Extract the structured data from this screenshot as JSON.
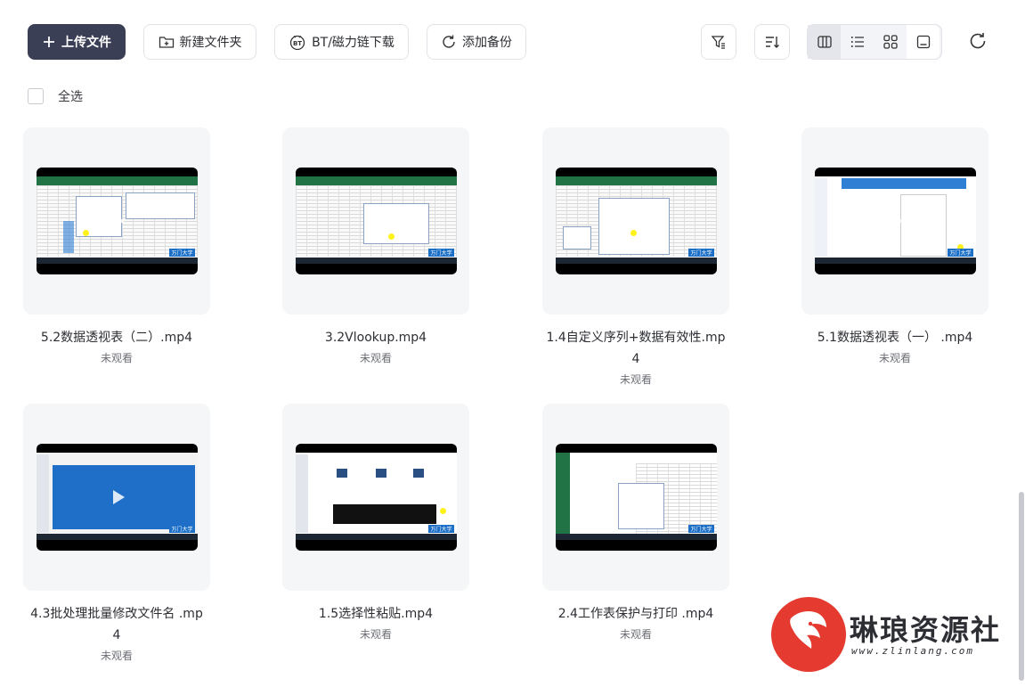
{
  "toolbar": {
    "upload_label": "上传文件",
    "new_folder_label": "新建文件夹",
    "bt_label": "BT/磁力链下载",
    "backup_label": "添加备份",
    "icons": {
      "upload": "plus-icon",
      "new_folder": "folder-plus-icon",
      "bt": "bt-icon",
      "backup": "sync-icon",
      "filter": "filter-icon",
      "sort": "sort-icon",
      "view_columns": "columns-icon",
      "view_list": "list-icon",
      "view_grid": "grid-icon",
      "view_preview": "preview-icon",
      "refresh": "refresh-icon"
    }
  },
  "select_all_label": "全选",
  "files": [
    {
      "name": "5.2数据透视表（二）.mp4",
      "status": "未观看"
    },
    {
      "name": "3.2Vlookup.mp4",
      "status": "未观看"
    },
    {
      "name": "1.4自定义序列+数据有效性.mp4",
      "status": "未观看"
    },
    {
      "name": "5.1数据透视表（一） .mp4",
      "status": "未观看"
    },
    {
      "name": "4.3批处理批量修改文件名 .mp4",
      "status": "未观看"
    },
    {
      "name": "1.5选择性粘贴.mp4",
      "status": "未观看"
    },
    {
      "name": "2.4工作表保护与打印 .mp4",
      "status": "未观看"
    }
  ],
  "thumb_brand": "万门大学",
  "watermark": {
    "title": "琳琅资源社",
    "url": "www.zlinlang.com"
  },
  "colors": {
    "primary": "#3b3f55",
    "excel_green": "#217346",
    "watermark_red": "#e53a2f"
  }
}
